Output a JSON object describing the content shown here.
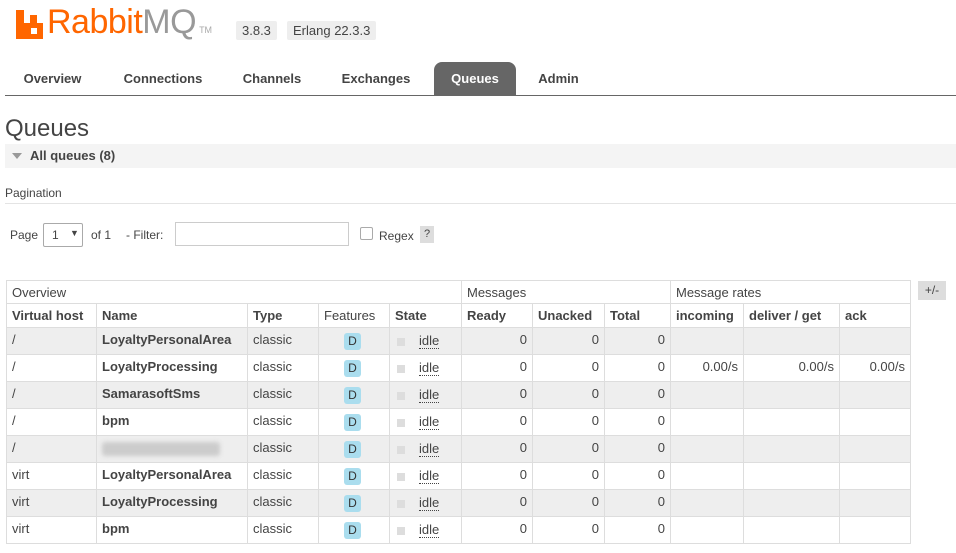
{
  "app": {
    "logo_rabbit": "Rabbit",
    "logo_mq": "MQ",
    "logo_tm": "TM",
    "version": "3.8.3",
    "erlang": "Erlang 22.3.3"
  },
  "tabs": [
    "Overview",
    "Connections",
    "Channels",
    "Exchanges",
    "Queues",
    "Admin"
  ],
  "active_tab": "Queues",
  "page": {
    "title": "Queues",
    "section": "All queues (8)"
  },
  "pagination": {
    "label": "Pagination",
    "page_label": "Page",
    "page_value": "1",
    "of_label": "of 1",
    "filter_label": "- Filter:",
    "filter_value": "",
    "regex_label": "Regex",
    "help_label": "?"
  },
  "table": {
    "groups": [
      "Overview",
      "Messages",
      "Message rates"
    ],
    "columns": [
      "Virtual host",
      "Name",
      "Type",
      "Features",
      "State",
      "Ready",
      "Unacked",
      "Total",
      "incoming",
      "deliver / get",
      "ack"
    ],
    "toggle_label": "+/-",
    "rows": [
      {
        "vhost": "/",
        "name": "LoyaltyPersonalArea",
        "type": "classic",
        "feature": "D",
        "state": "idle",
        "ready": "0",
        "unacked": "0",
        "total": "0",
        "incoming": "",
        "deliver": "",
        "ack": ""
      },
      {
        "vhost": "/",
        "name": "LoyaltyProcessing",
        "type": "classic",
        "feature": "D",
        "state": "idle",
        "ready": "0",
        "unacked": "0",
        "total": "0",
        "incoming": "0.00/s",
        "deliver": "0.00/s",
        "ack": "0.00/s"
      },
      {
        "vhost": "/",
        "name": "SamarasoftSms",
        "type": "classic",
        "feature": "D",
        "state": "idle",
        "ready": "0",
        "unacked": "0",
        "total": "0",
        "incoming": "",
        "deliver": "",
        "ack": ""
      },
      {
        "vhost": "/",
        "name": "bpm",
        "type": "classic",
        "feature": "D",
        "state": "idle",
        "ready": "0",
        "unacked": "0",
        "total": "0",
        "incoming": "",
        "deliver": "",
        "ack": ""
      },
      {
        "vhost": "/",
        "name": "",
        "type": "classic",
        "feature": "D",
        "state": "idle",
        "ready": "0",
        "unacked": "0",
        "total": "0",
        "incoming": "",
        "deliver": "",
        "ack": ""
      },
      {
        "vhost": "virt",
        "name": "LoyaltyPersonalArea",
        "type": "classic",
        "feature": "D",
        "state": "idle",
        "ready": "0",
        "unacked": "0",
        "total": "0",
        "incoming": "",
        "deliver": "",
        "ack": ""
      },
      {
        "vhost": "virt",
        "name": "LoyaltyProcessing",
        "type": "classic",
        "feature": "D",
        "state": "idle",
        "ready": "0",
        "unacked": "0",
        "total": "0",
        "incoming": "",
        "deliver": "",
        "ack": ""
      },
      {
        "vhost": "virt",
        "name": "bpm",
        "type": "classic",
        "feature": "D",
        "state": "idle",
        "ready": "0",
        "unacked": "0",
        "total": "0",
        "incoming": "",
        "deliver": "",
        "ack": ""
      }
    ]
  },
  "colors": {
    "brand": "#ff6600",
    "tab_active": "#666666",
    "feature_badge": "#aaddee"
  }
}
